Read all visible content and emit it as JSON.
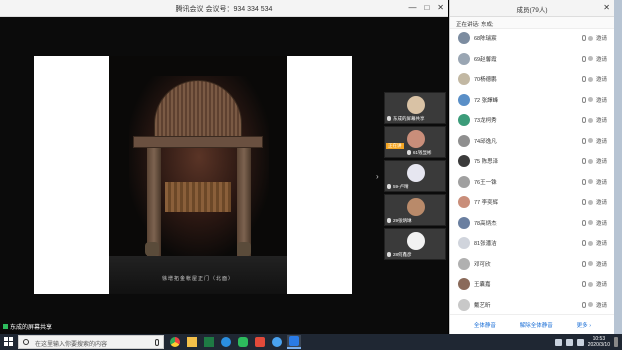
{
  "meeting": {
    "title": "腾讯会议 会议号：934 334 534",
    "window_controls": [
      "—",
      "□",
      "✕"
    ],
    "photo_caption": "徐增拓金帐屋正门（北面）",
    "share_indicator": "东成的屏幕共享",
    "video_tiles": [
      {
        "name": "东成的屏幕共享",
        "speaking": false
      },
      {
        "name": "61钱显彬",
        "speaking": true,
        "speaking_label": "正在讲"
      },
      {
        "name": "59-卢晴",
        "speaking": false
      },
      {
        "name": "29张炳琳",
        "speaking": false
      },
      {
        "name": "28何鑫彦",
        "speaking": false
      }
    ]
  },
  "members_panel": {
    "title": "成员(79人)",
    "speaking_now": "正在讲话: 东成;",
    "members": [
      {
        "name": "68陈瑞宸",
        "action": "邀请"
      },
      {
        "name": "69赵馨霞",
        "action": "邀请"
      },
      {
        "name": "70杨德鹏",
        "action": "邀请"
      },
      {
        "name": "72 张譯峰",
        "action": "邀请"
      },
      {
        "name": "73龙柯秀",
        "action": "邀请"
      },
      {
        "name": "74邱逸凡",
        "action": "邀请"
      },
      {
        "name": "75 陈思泽",
        "action": "邀请"
      },
      {
        "name": "76王一铢",
        "action": "邀请"
      },
      {
        "name": "77 李奕辉",
        "action": "邀请"
      },
      {
        "name": "78高炳杰",
        "action": "邀请"
      },
      {
        "name": "81张潘洁",
        "action": "邀请"
      },
      {
        "name": "邓可欣",
        "action": "邀请"
      },
      {
        "name": "王囊嘉",
        "action": "邀请"
      },
      {
        "name": "戴艺昕",
        "action": "邀请"
      }
    ],
    "footer": {
      "mute_all": "全体静音",
      "unmute_all": "解除全体静音",
      "more": "更多 ›"
    }
  },
  "taskbar": {
    "search_placeholder": "在这里输入你要搜索的内容",
    "time": "10:53",
    "date": "2020/3/10",
    "icons": [
      "chrome-icon",
      "file-explorer-icon",
      "excel-icon",
      "edge-icon",
      "weixin-icon",
      "wps-icon",
      "qq-icon",
      "tencent-meeting-icon"
    ]
  },
  "colors": {
    "link_blue": "#1b6fd6",
    "speaking_orange": "#f5a623",
    "taskbar": "#1f2733"
  }
}
